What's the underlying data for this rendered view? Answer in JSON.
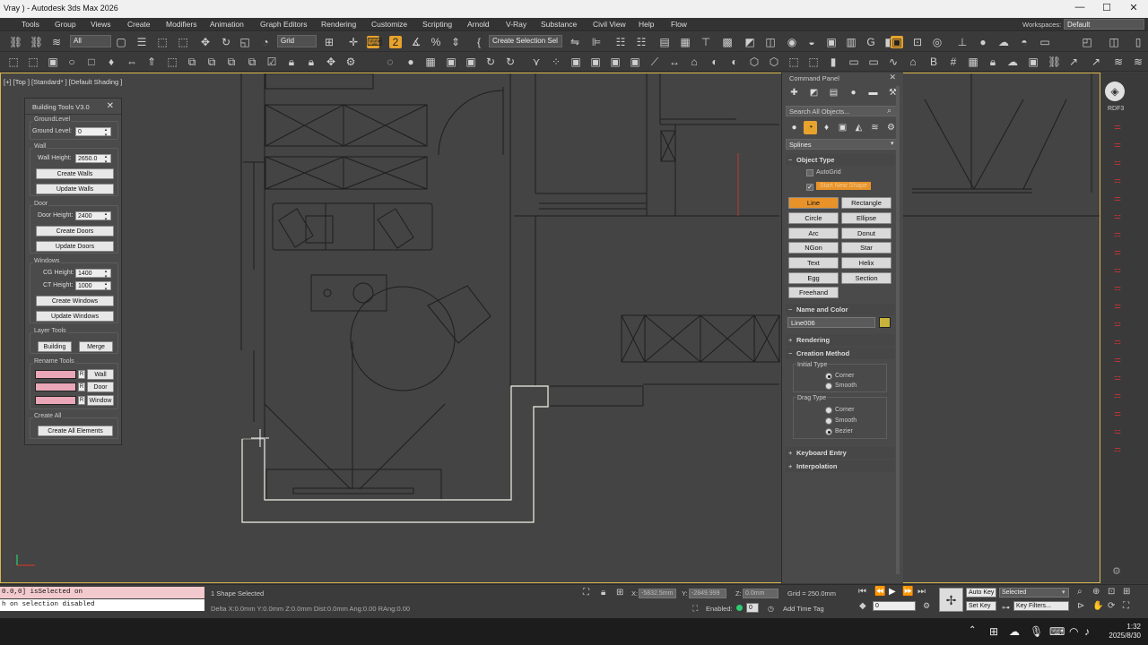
{
  "window": {
    "title": "Vray ) - Autodesk 3ds Max 2026",
    "min": "—",
    "max": "☐",
    "close": "✕"
  },
  "menu": {
    "items": [
      "Tools",
      "Group",
      "Views",
      "Create",
      "Modifiers",
      "Animation",
      "Graph Editors",
      "Rendering",
      "Customize",
      "Scripting",
      "Arnold",
      "V-Ray",
      "Substance",
      "Civil View",
      "Help",
      "Flow"
    ],
    "workspaces_label": "Workspaces:",
    "workspace": "Default"
  },
  "toolbar": {
    "filter": "All",
    "ref_coord": "Grid",
    "selection_set": "Create Selection Sel"
  },
  "viewport": {
    "label": "[+] [Top ] [Standard* ] [Default Shading ]"
  },
  "building_tools": {
    "title": "Building Tools V3.0",
    "close": "✕",
    "ground": {
      "group": "GroundLevel",
      "label": "Ground Level:",
      "value": "0"
    },
    "wall": {
      "group": "Wall",
      "label": "Wall Height:",
      "value": "2650.0",
      "create": "Create Walls",
      "update": "Update Walls"
    },
    "door": {
      "group": "Door",
      "label": "Door Height:",
      "value": "2400",
      "create": "Create Doors",
      "update": "Update Doors"
    },
    "windows": {
      "group": "Windows",
      "cg_label": "CG Height:",
      "cg_value": "1400",
      "ct_label": "CT Height:",
      "ct_value": "1000",
      "create": "Create Windows",
      "update": "Update Windows"
    },
    "layer_tools": {
      "group": "Layer Tools",
      "building": "Building",
      "merge": "Merge"
    },
    "rename_tools": {
      "group": "Rename Tools",
      "wall": "Wall",
      "door": "Door",
      "window": "Window",
      "check": "R"
    },
    "create_all": {
      "group": "Create All",
      "button": "Create All Elements"
    }
  },
  "command_panel": {
    "title": "Command Panel",
    "close": "✕",
    "search_placeholder": "Search All Objects...",
    "category": "Splines",
    "object_type": {
      "header": "Object Type",
      "autogrid": "AutoGrid",
      "start_new_shape": "Start New Shape",
      "buttons": [
        "Line",
        "Rectangle",
        "Circle",
        "Ellipse",
        "Arc",
        "Donut",
        "NGon",
        "Star",
        "Text",
        "Helix",
        "Egg",
        "Section",
        "Freehand"
      ],
      "active": "Line"
    },
    "name_color": {
      "header": "Name and Color",
      "name": "Line006",
      "color": "#c8b43c"
    },
    "rendering": "Rendering",
    "creation_method": {
      "header": "Creation Method",
      "initial_type": "Initial Type",
      "initial_options": [
        "Corner",
        "Smooth"
      ],
      "initial_selected": "Corner",
      "drag_type": "Drag Type",
      "drag_options": [
        "Corner",
        "Smooth",
        "Bezier"
      ],
      "drag_selected": "Bezier"
    },
    "keyboard_entry": "Keyboard Entry",
    "interpolation": "Interpolation"
  },
  "right_toolbar": {
    "label": "RDF3"
  },
  "status": {
    "script_line1": "0.0,0] isSelected on",
    "script_line2": "h on selection disabled",
    "selection": "1 Shape Selected",
    "delta": "Delta X:0.0mm  Y:0.0mm  Z:0.0mm  Dist:0.0mm  Ang:0.00  RAng:0.00",
    "x_label": "X:",
    "x_value": "-5832.5mm",
    "y_label": "Y:",
    "y_value": "-2849.999",
    "z_label": "Z:",
    "z_value": "0.0mm",
    "grid": "Grid = 250.0mm",
    "enabled": "Enabled:",
    "frame": "0",
    "add_time_tag": "Add Time Tag",
    "auto_key": "Auto Key",
    "set_key": "Set Key",
    "key_mode": "Selected",
    "key_filters": "Key Filters...",
    "current_frame": "0"
  },
  "taskbar": {
    "time": "1:32",
    "date": "2025/8/30"
  }
}
